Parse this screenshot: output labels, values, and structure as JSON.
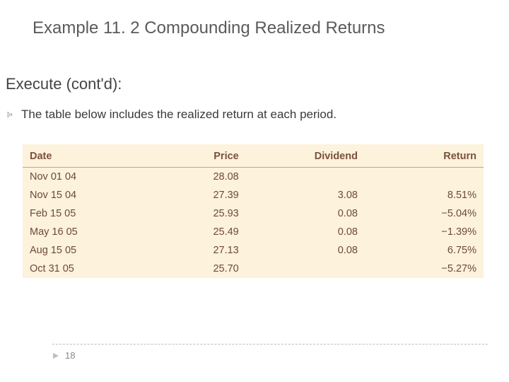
{
  "title": "Example 11. 2 Compounding Realized Returns",
  "subhead": "Execute (cont'd):",
  "bullet_text": "The table below includes the realized return at each period.",
  "page_number": "18",
  "table": {
    "headers": {
      "date": "Date",
      "price": "Price",
      "dividend": "Dividend",
      "return": "Return"
    },
    "rows": [
      {
        "date": "Nov 01 04",
        "price": "28.08",
        "dividend": "",
        "return": ""
      },
      {
        "date": "Nov 15 04",
        "price": "27.39",
        "dividend": "3.08",
        "return": "8.51%"
      },
      {
        "date": "Feb 15 05",
        "price": "25.93",
        "dividend": "0.08",
        "return": "−5.04%"
      },
      {
        "date": "May 16 05",
        "price": "25.49",
        "dividend": "0.08",
        "return": "−1.39%"
      },
      {
        "date": "Aug 15 05",
        "price": "27.13",
        "dividend": "0.08",
        "return": "6.75%"
      },
      {
        "date": "Oct 31 05",
        "price": "25.70",
        "dividend": "",
        "return": "−5.27%"
      }
    ]
  },
  "chart_data": {
    "type": "table",
    "columns": [
      "Date",
      "Price",
      "Dividend",
      "Return"
    ],
    "rows": [
      [
        "Nov 01 04",
        28.08,
        null,
        null
      ],
      [
        "Nov 15 04",
        27.39,
        3.08,
        0.0851
      ],
      [
        "Feb 15 05",
        25.93,
        0.08,
        -0.0504
      ],
      [
        "May 16 05",
        25.49,
        0.08,
        -0.0139
      ],
      [
        "Aug 15 05",
        27.13,
        0.08,
        0.0675
      ],
      [
        "Oct 31 05",
        25.7,
        null,
        -0.0527
      ]
    ],
    "title": "Realized return at each period"
  }
}
